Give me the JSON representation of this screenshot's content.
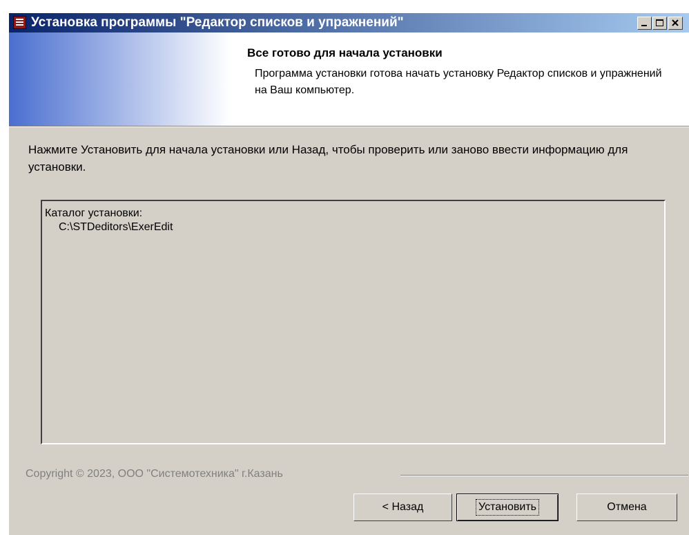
{
  "window": {
    "title": "Установка программы \"Редактор списков и упражнений\""
  },
  "header": {
    "title": "Все готово для начала установки",
    "subtitle": "Программа установки готова начать установку Редактор списков и упражнений на Ваш компьютер."
  },
  "body": {
    "instruction": "Нажмите Установить для начала установки или Назад, чтобы проверить или заново ввести информацию для установки.",
    "memo": {
      "label": "Каталог установки:",
      "path": "C:\\STDeditors\\ExerEdit"
    }
  },
  "footer": {
    "copyright": "Copyright © 2023, ООО \"Системотехника\" г.Казань"
  },
  "buttons": {
    "back": "< Назад",
    "install": "Установить",
    "cancel": "Отмена"
  },
  "icons": {
    "app": "app-list-icon",
    "minimize": "minimize-icon",
    "maximize": "maximize-icon",
    "close": "close-icon"
  },
  "colors": {
    "title_bar_start": "#0a246a",
    "title_bar_end": "#a6caf0",
    "dialog_face": "#d4d0c8"
  }
}
